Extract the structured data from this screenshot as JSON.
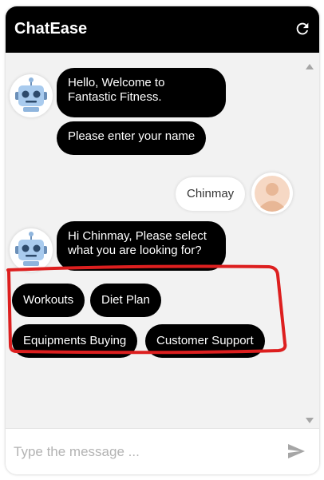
{
  "app": {
    "title": "ChatEase"
  },
  "icons": {
    "refresh": "refresh-icon",
    "bot": "robot-avatar-icon",
    "user": "user-avatar-icon",
    "send": "send-icon"
  },
  "colors": {
    "header": "#000000",
    "bubble": "#000000",
    "annotation": "#dd1f1f"
  },
  "messages": {
    "bot_welcome": "Hello, Welcome to Fantastic Fitness.",
    "bot_name_prompt": "Please enter your name",
    "user_name": "Chinmay",
    "bot_select_prompt": "Hi Chinmay, Please select what you are looking for?"
  },
  "options": [
    "Workouts",
    "Diet Plan",
    "Equipments Buying",
    "Customer Support"
  ],
  "input": {
    "placeholder": "Type the message ..."
  }
}
